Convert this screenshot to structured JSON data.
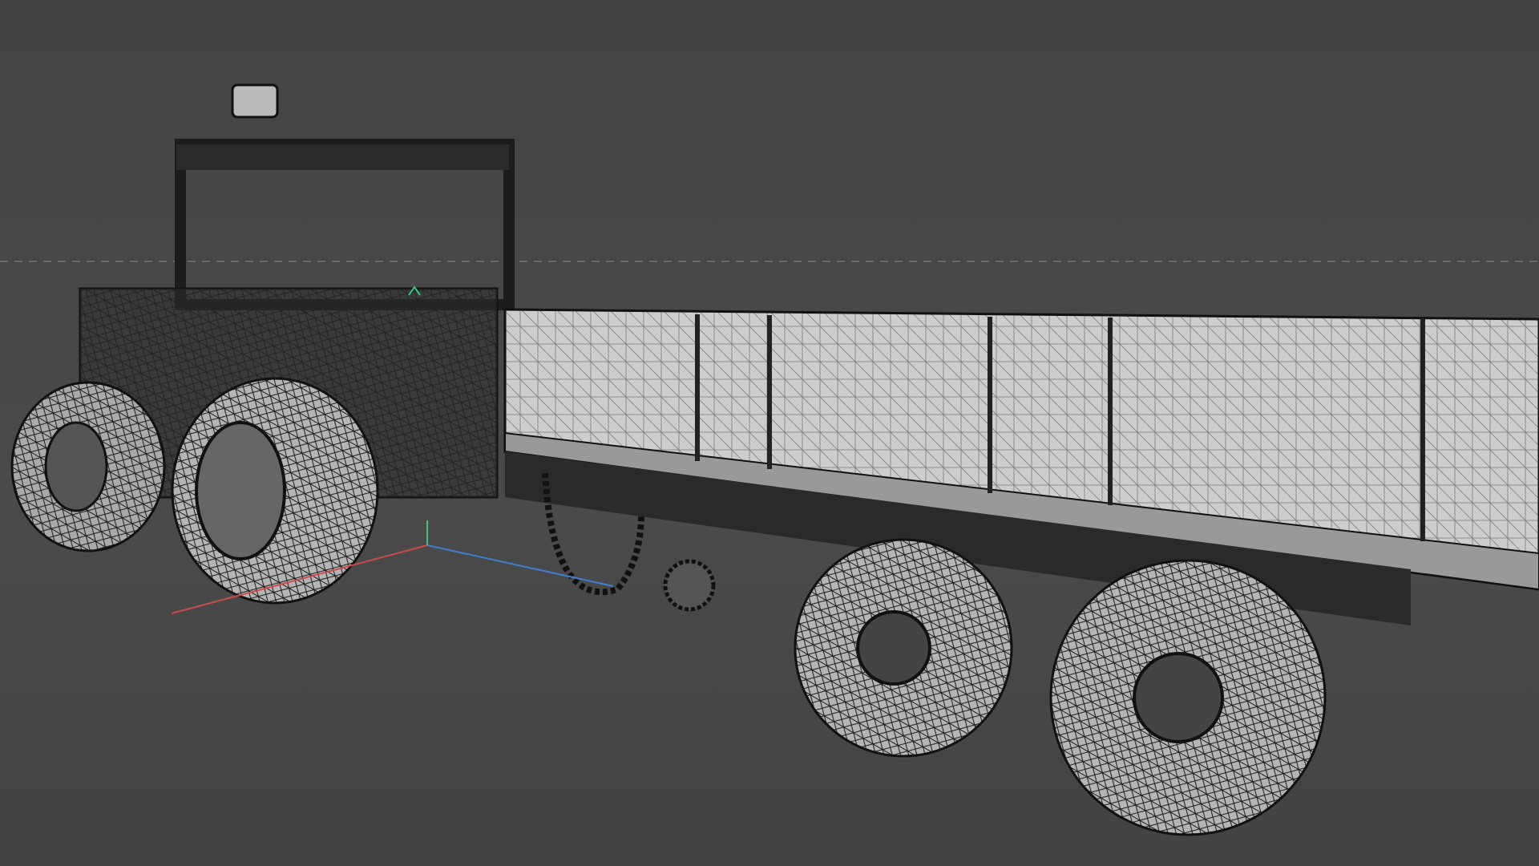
{
  "viewport": {
    "background": "#474747",
    "axis_colors": {
      "x": "#d04a4a",
      "y": "#3fc07a",
      "z": "#3f7fd0"
    },
    "wire_color": "#1a1a1a",
    "surface_color": "#c8c8c8",
    "horizon_color": "#777777"
  }
}
